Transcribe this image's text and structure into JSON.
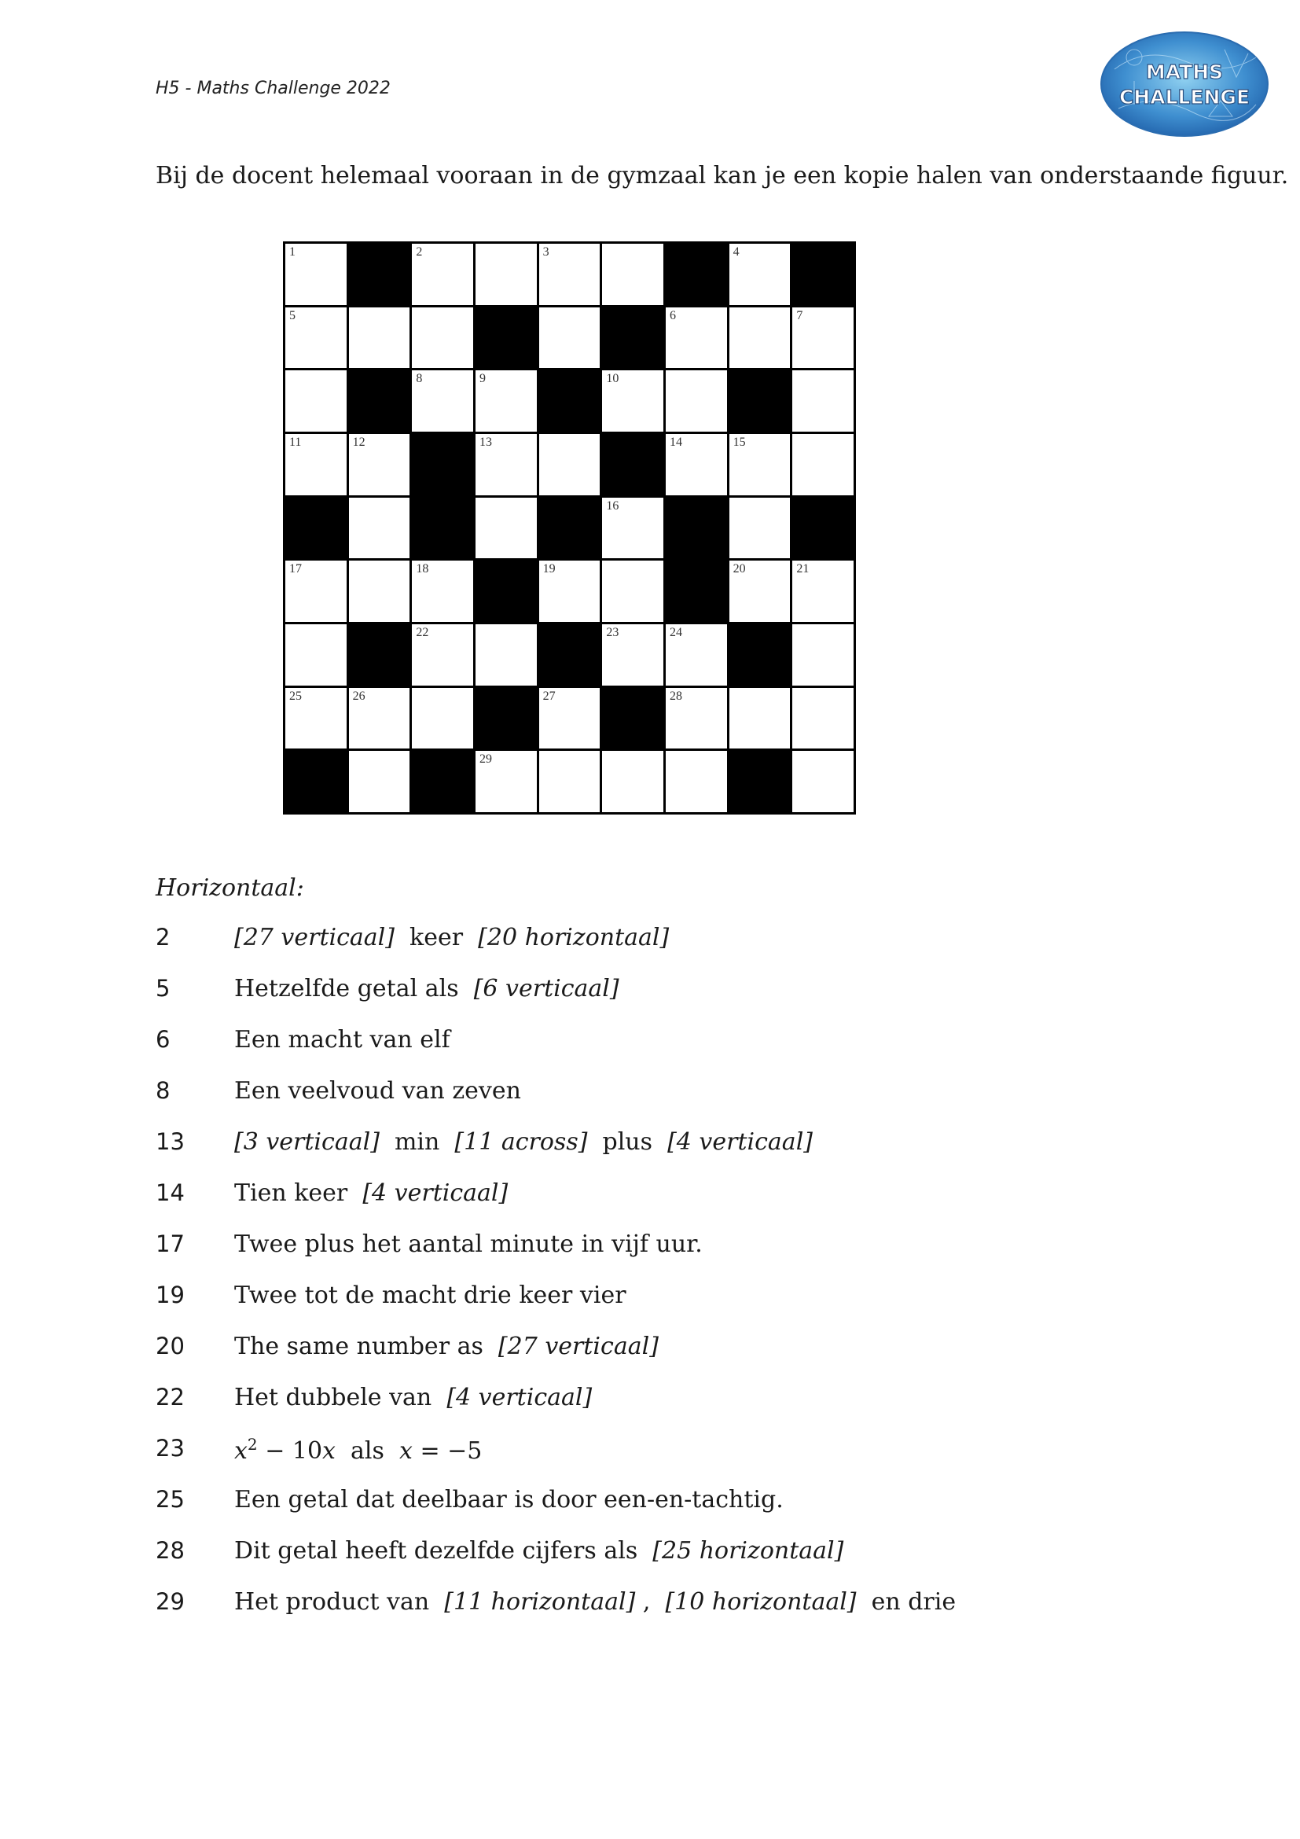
{
  "header": {
    "title": "H5 - Maths Challenge 2022",
    "logo_text": [
      "MATHS",
      "CHALLENGE"
    ]
  },
  "intro": "Bij de docent helemaal vooraan in de gymzaal kan je een kopie halen van onderstaande figuur.",
  "crossword": {
    "rows": [
      [
        "1",
        "#",
        "2",
        "",
        "3",
        "",
        "#",
        "4",
        "#"
      ],
      [
        "5",
        "",
        "",
        "#",
        "",
        "#",
        "6",
        "",
        "7"
      ],
      [
        "",
        "#",
        "8",
        "9",
        "#",
        "10",
        "",
        "#",
        ""
      ],
      [
        "11",
        "12",
        "#",
        "13",
        "",
        "#",
        "14",
        "15",
        ""
      ],
      [
        "#",
        "",
        "#",
        "",
        "#",
        "16",
        "#",
        "",
        "#"
      ],
      [
        "17",
        "",
        "18",
        "#",
        "19",
        "",
        "#",
        "20",
        "21"
      ],
      [
        "",
        "#",
        "22",
        "",
        "#",
        "23",
        "24",
        "#",
        ""
      ],
      [
        "25",
        "26",
        "",
        "#",
        "27",
        "#",
        "28",
        "",
        ""
      ],
      [
        "#",
        "",
        "#",
        "29",
        "",
        "",
        "",
        "#",
        ""
      ]
    ]
  },
  "section_heading": "Horizontaal:",
  "clues": [
    {
      "number": "2",
      "parts": [
        [
          "ref",
          "[27 verticaal]"
        ],
        [
          "txt",
          "  keer  "
        ],
        [
          "ref",
          "[20 horizontaal]"
        ]
      ]
    },
    {
      "number": "5",
      "parts": [
        [
          "txt",
          "Hetzelfde getal als  "
        ],
        [
          "ref",
          "[6 verticaal]"
        ]
      ]
    },
    {
      "number": "6",
      "parts": [
        [
          "txt",
          "Een macht van elf"
        ]
      ]
    },
    {
      "number": "8",
      "parts": [
        [
          "txt",
          "Een veelvoud van zeven"
        ]
      ]
    },
    {
      "number": "13",
      "parts": [
        [
          "ref",
          "[3 verticaal]"
        ],
        [
          "txt",
          "  min  "
        ],
        [
          "ref",
          "[11 across]"
        ],
        [
          "txt",
          "  plus  "
        ],
        [
          "ref",
          "[4 verticaal]"
        ]
      ]
    },
    {
      "number": "14",
      "parts": [
        [
          "txt",
          "Tien keer  "
        ],
        [
          "ref",
          "[4 verticaal]"
        ]
      ]
    },
    {
      "number": "17",
      "parts": [
        [
          "txt",
          "Twee plus het aantal minute in vijf uur."
        ]
      ]
    },
    {
      "number": "19",
      "parts": [
        [
          "txt",
          "Twee tot de macht drie keer vier"
        ]
      ]
    },
    {
      "number": "20",
      "parts": [
        [
          "txt",
          "The same number as  "
        ],
        [
          "ref",
          "[27 verticaal]"
        ]
      ]
    },
    {
      "number": "22",
      "parts": [
        [
          "txt",
          "Het dubbele van  "
        ],
        [
          "ref",
          "[4 verticaal]"
        ]
      ]
    },
    {
      "number": "23",
      "parts": [
        [
          "math",
          "x"
        ],
        [
          "sup",
          "2"
        ],
        [
          "mathu",
          " − 10"
        ],
        [
          "math",
          "x"
        ],
        [
          "txt",
          "  als  "
        ],
        [
          "math",
          "x"
        ],
        [
          "mathu",
          " = −5"
        ]
      ]
    },
    {
      "number": "25",
      "parts": [
        [
          "txt",
          "Een getal dat deelbaar is door een-en-tachtig."
        ]
      ]
    },
    {
      "number": "28",
      "parts": [
        [
          "txt",
          "Dit getal heeft dezelfde cijfers als  "
        ],
        [
          "ref",
          "[25 horizontaal]"
        ]
      ]
    },
    {
      "number": "29",
      "parts": [
        [
          "txt",
          "Het product van  "
        ],
        [
          "ref",
          "[11 horizontaal]"
        ],
        [
          "txt",
          " ,  "
        ],
        [
          "ref",
          "[10 horizontaal]"
        ],
        [
          "txt",
          "  en drie"
        ]
      ]
    }
  ]
}
